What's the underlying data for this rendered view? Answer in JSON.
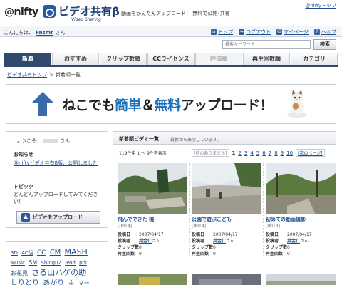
{
  "header": {
    "nifty_logo": "@nifty",
    "service_title": "ビデオ共有β",
    "service_subtitle": "Video Sharing",
    "tagline": "動画をかんたんアップロード！ 無料で公開･共有",
    "nifty_top_link": "@niftyトップ"
  },
  "userbar": {
    "greeting_prefix": "こんにちは、",
    "username": "knsmr",
    "greeting_suffix": "さん",
    "links": [
      {
        "icon": "home-icon",
        "label": "トップ"
      },
      {
        "icon": "logout-icon",
        "label": "ログアウト"
      },
      {
        "icon": "mypage-icon",
        "label": "マイページ"
      },
      {
        "icon": "help-icon",
        "label": "ヘルプ"
      }
    ]
  },
  "search": {
    "placeholder": "検索キーワード",
    "button_label": "検索"
  },
  "tabs": [
    {
      "label": "新着",
      "state": "active"
    },
    {
      "label": "おすすめ",
      "state": "normal"
    },
    {
      "label": "クリップ数順",
      "state": "normal"
    },
    {
      "label": "CCライセンス",
      "state": "normal"
    },
    {
      "label": "評価順",
      "state": "disabled"
    },
    {
      "label": "再生回数順",
      "state": "normal"
    },
    {
      "label": "カテゴリ",
      "state": "normal"
    }
  ],
  "breadcrumb": {
    "home": "ビデオ共有トップ",
    "separator": ">",
    "current": "新着順一覧"
  },
  "banner": {
    "text_a": "ねこでも",
    "text_b": "簡単",
    "text_c": "＆",
    "text_d": "無料",
    "text_e": "アップロード！"
  },
  "sidebar": {
    "welcome_prefix": "ようこそ、",
    "welcome_suffix": "さん",
    "notice_heading": "お知らせ",
    "notice_link": "@niftyビデオ共有β版、公開しました",
    "topic_heading": "トピック",
    "topic_text": "どんどんアップロードしてみてください！",
    "upload_button": "ビデオをアップロード"
  },
  "tags": [
    "3D",
    "AC版",
    "CC",
    "CM",
    "MASH",
    "Music",
    "SM",
    "Shing02",
    "iPod",
    "poi",
    "お花見",
    "さる山ハゲの助",
    "しりとり",
    "あがり",
    "主",
    "マー"
  ],
  "list": {
    "title": "新着順ビデオ一覧",
    "note": "最新から表示しています。",
    "count": "119件中 1 ～ 9件を表示",
    "prev": "前のありません",
    "pages": [
      "1",
      "2",
      "3",
      "4",
      "5",
      "6",
      "7",
      "8",
      "9",
      "10"
    ],
    "current_page": "1",
    "next": "次のページ",
    "labels": {
      "posted": "投稿日",
      "poster": "投稿者",
      "clips": "クリップ数",
      "plays": "再生回数"
    },
    "videos": [
      {
        "title": "飛んでできた 桃",
        "id": "[0014]",
        "date": "2007/04/17",
        "user": "井金仁",
        "user_suffix": "さん",
        "clips": "0",
        "plays": "0"
      },
      {
        "title": "公園で遊ぶこども",
        "id": "[0014]",
        "date": "2007/04/17",
        "user": "井金仁",
        "user_suffix": "さん",
        "clips": "0",
        "plays": "0"
      },
      {
        "title": "初めての動画撮影",
        "id": "[0013]",
        "date": "2007/04/17",
        "user": "井金仁",
        "user_suffix": "さん",
        "clips": "0",
        "plays": "0"
      }
    ]
  },
  "colors": {
    "accent": "#2f4a6a",
    "link": "#1a4f8f",
    "banner_highlight": "#1f6fb8"
  }
}
